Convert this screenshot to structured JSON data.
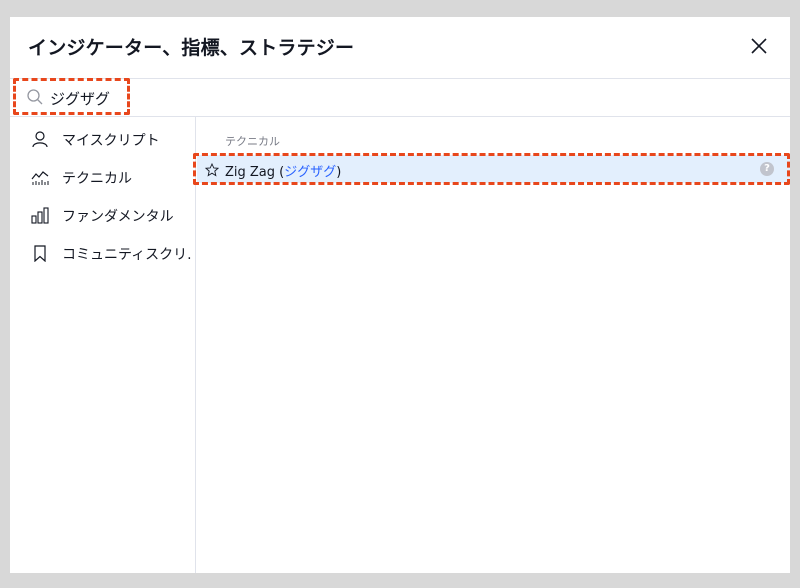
{
  "dialog": {
    "title": "インジケーター、指標、ストラテジー",
    "close_icon": "close-icon"
  },
  "search": {
    "value": "ジグザグ",
    "placeholder": "検索",
    "icon": "search-icon"
  },
  "sidebar": {
    "items": [
      {
        "label": "マイスクリプト",
        "icon": "user-icon"
      },
      {
        "label": "テクニカル",
        "icon": "technical-chart-icon"
      },
      {
        "label": "ファンダメンタル",
        "icon": "bar-chart-icon"
      },
      {
        "label": "コミュニティスクリ...",
        "icon": "bookmark-icon"
      }
    ]
  },
  "main": {
    "section_title": "テクニカル",
    "results": [
      {
        "name": "Zig Zag (",
        "alias": "ジグザグ",
        "suffix": ")",
        "favorite_icon": "star-icon",
        "info_icon": "info-icon",
        "info_glyph": "?"
      }
    ]
  },
  "colors": {
    "highlight_border": "#e8471c",
    "selected_row_bg": "#e3effd",
    "link_blue": "#2962ff",
    "backdrop": "#d8d8d8"
  }
}
